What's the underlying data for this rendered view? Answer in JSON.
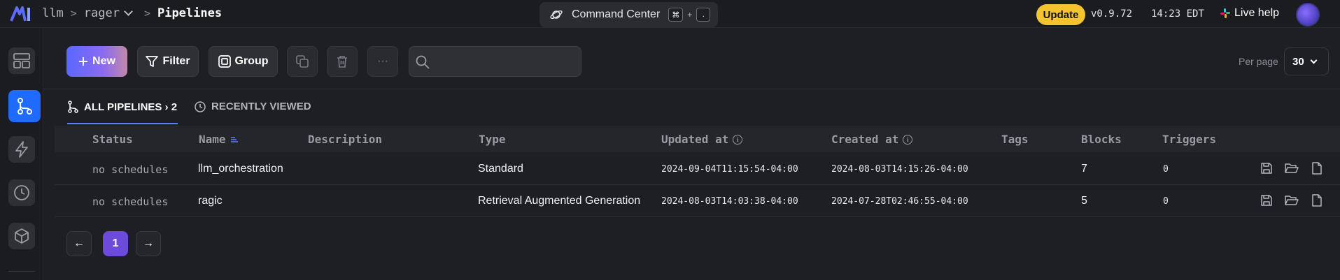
{
  "header": {
    "breadcrumbs": [
      "llm",
      "rager",
      "Pipelines"
    ],
    "separator": ">",
    "command_center": {
      "label": "Command Center",
      "key1": "⌘",
      "plus": "+",
      "key2": "."
    },
    "update_label": "Update",
    "version": "v0.9.72",
    "time": "14:23 EDT",
    "help_label": "Live help"
  },
  "sidebar": {
    "items": [
      {
        "icon": "layout-icon",
        "active": false
      },
      {
        "icon": "pipeline-icon",
        "active": true
      },
      {
        "icon": "lightning-icon",
        "active": false
      },
      {
        "icon": "clock-icon",
        "active": false
      },
      {
        "icon": "cube-icon",
        "active": false
      }
    ]
  },
  "toolbar": {
    "new_label": "New",
    "filter_label": "Filter",
    "group_label": "Group",
    "more_label": "···",
    "search_placeholder": "",
    "per_page_label": "Per page",
    "per_page_value": "30"
  },
  "tabs": {
    "all_label": "ALL PIPELINES › 2",
    "recent_label": "RECENTLY VIEWED"
  },
  "table": {
    "columns": [
      "Status",
      "Name",
      "Description",
      "Type",
      "Updated at",
      "Created at",
      "Tags",
      "Blocks",
      "Triggers"
    ],
    "rows": [
      {
        "status": "no schedules",
        "name": "llm_orchestration",
        "description": "",
        "type": "Standard",
        "updated_at": "2024-09-04T11:15:54-04:00",
        "created_at": "2024-08-03T14:15:26-04:00",
        "tags": "",
        "blocks": "7",
        "triggers": "0"
      },
      {
        "status": "no schedules",
        "name": "ragic",
        "description": "",
        "type": "Retrieval Augmented Generation",
        "updated_at": "2024-08-03T14:03:38-04:00",
        "created_at": "2024-07-28T02:46:55-04:00",
        "tags": "",
        "blocks": "5",
        "triggers": "0"
      }
    ]
  },
  "pagination": {
    "prev": "←",
    "current": "1",
    "next": "→"
  },
  "colors": {
    "accent": "#1f6bff",
    "update": "#f4c430",
    "page_active": "#6c4bdc"
  }
}
